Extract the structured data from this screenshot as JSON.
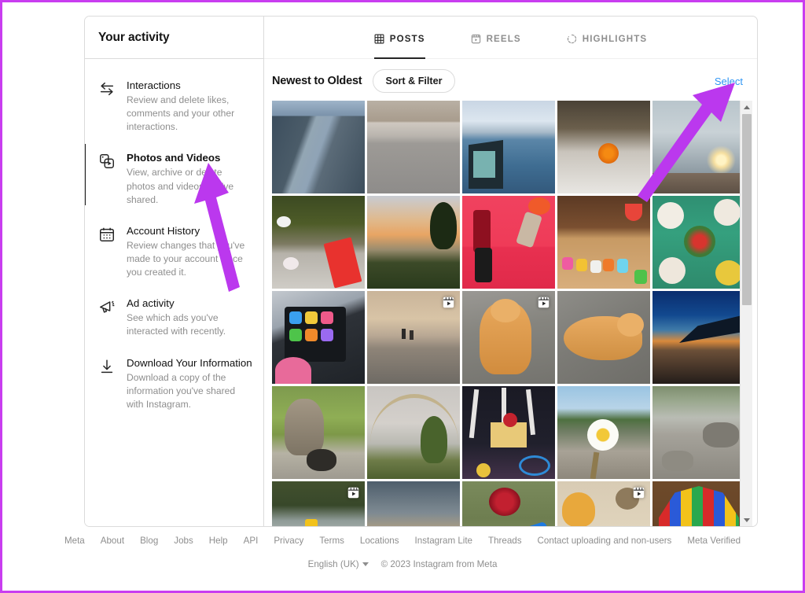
{
  "sidebar": {
    "header": "Your activity",
    "items": [
      {
        "title": "Interactions",
        "desc": "Review and delete likes, comments and your other interactions.",
        "icon": "interactions-arrows-icon",
        "active": false
      },
      {
        "title": "Photos and Videos",
        "desc": "View, archive or delete photos and videos you've shared.",
        "icon": "photos-videos-icon",
        "active": true
      },
      {
        "title": "Account History",
        "desc": "Review changes that you've made to your account since you created it.",
        "icon": "calendar-icon",
        "active": false
      },
      {
        "title": "Ad activity",
        "desc": "See which ads you've interacted with recently.",
        "icon": "megaphone-icon",
        "active": false
      },
      {
        "title": "Download Your Information",
        "desc": "Download a copy of the information you've shared with Instagram.",
        "icon": "download-icon",
        "active": false
      }
    ]
  },
  "main": {
    "tabs": [
      {
        "label": "POSTS",
        "icon": "grid-icon",
        "active": true
      },
      {
        "label": "REELS",
        "icon": "reels-clapper-icon",
        "active": false
      },
      {
        "label": "HIGHLIGHTS",
        "icon": "highlights-circle-icon",
        "active": false
      }
    ],
    "sort_title": "Newest to Oldest",
    "sort_button": "Sort & Filter",
    "select_link": "Select",
    "select_link_color": "#2e95f4",
    "grid": {
      "columns": 5,
      "tiles": [
        {
          "caption": "river valley between mountains",
          "badge": null
        },
        {
          "caption": "gravel road through barren hills",
          "badge": null
        },
        {
          "caption": "snow mountains across blue lake with gate",
          "badge": null
        },
        {
          "caption": "orange flower on snowy ground",
          "badge": null
        },
        {
          "caption": "birds on lake shore at sunrise",
          "badge": null
        },
        {
          "caption": "red and white flowers with red book",
          "badge": null
        },
        {
          "caption": "orange sunset clouds over trees",
          "badge": null
        },
        {
          "caption": "phones arranged on pink background",
          "badge": null
        },
        {
          "caption": "colourful toy animals on wooden floor",
          "badge": null
        },
        {
          "caption": "potted succulents on green mat",
          "badge": null
        },
        {
          "caption": "hand holding tablet with colourful app icons",
          "badge": null
        },
        {
          "caption": "people walking on beach at dusk",
          "badge": "reels-clapper-icon"
        },
        {
          "caption": "ginger cat on gravel",
          "badge": "reels-clapper-icon"
        },
        {
          "caption": "ginger cat lying on concrete",
          "badge": null
        },
        {
          "caption": "aeroplane wing at sunset",
          "badge": null
        },
        {
          "caption": "tabby cat with kitten on grass",
          "badge": null
        },
        {
          "caption": "rainbow over trees",
          "badge": null
        },
        {
          "caption": "decorated room with painted trees and bicycle",
          "badge": null
        },
        {
          "caption": "hand holding white daisy by river",
          "badge": null
        },
        {
          "caption": "rocky riverbed with mountains",
          "badge": null
        },
        {
          "caption": "river rapids with raft",
          "badge": "video-play-icon"
        },
        {
          "caption": "sunset over calm sea",
          "badge": null
        },
        {
          "caption": "red rose with blue phone",
          "badge": null
        },
        {
          "caption": "cartoon dogs toys",
          "badge": "video-play-icon"
        },
        {
          "caption": "stained glass archway",
          "badge": null
        }
      ]
    },
    "scrollbar": {
      "up": "scroll-up-arrow",
      "down": "scroll-down-arrow"
    }
  },
  "footer": {
    "links": [
      "Meta",
      "About",
      "Blog",
      "Jobs",
      "Help",
      "API",
      "Privacy",
      "Terms",
      "Locations",
      "Instagram Lite",
      "Threads",
      "Contact uploading and non-users",
      "Meta Verified"
    ],
    "language": "English (UK)",
    "copyright": "© 2023 Instagram from Meta"
  },
  "annotations": {
    "arrow_color": "#bb38ee",
    "arrows": [
      {
        "name": "arrow-to-photos-and-videos",
        "target": "Photos and Videos"
      },
      {
        "name": "arrow-to-select",
        "target": "Select"
      }
    ]
  }
}
